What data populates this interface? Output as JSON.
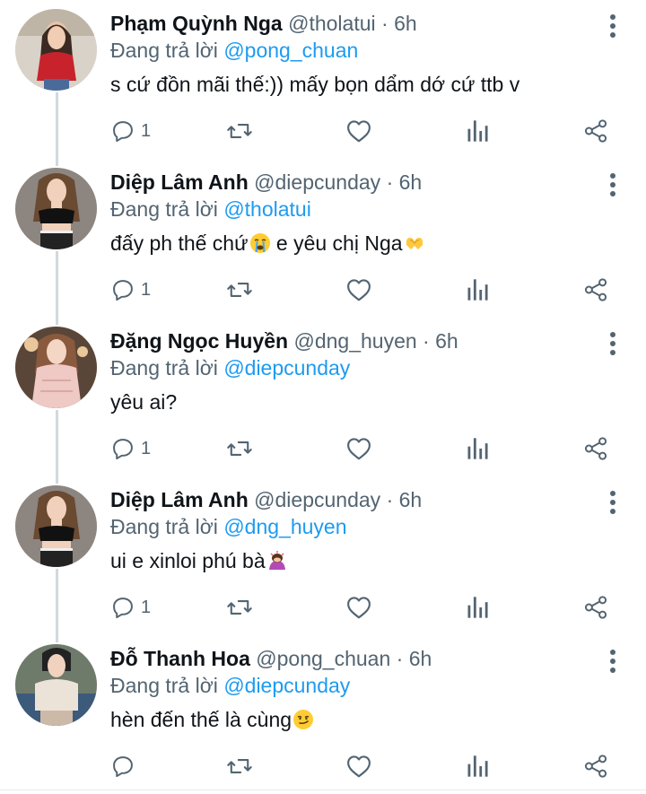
{
  "colors": {
    "link": "#1d9bf0",
    "secondary_text": "#536471",
    "primary_text": "#0f1419",
    "thread_line": "#cfd9de"
  },
  "tweets": [
    {
      "display_name": "Phạm Quỳnh Nga",
      "handle": "@tholatui",
      "separator": "·",
      "time": "6h",
      "replying_prefix": "Đang trả lời",
      "replying_to": "@pong_chuan",
      "text": "s cứ đồn mãi thế:)) mấy bọn dẩm dớ cứ ttb v",
      "emoji": "",
      "reply_count": "1",
      "avatar_icon": "woman-red-top-avatar"
    },
    {
      "display_name": "Diệp Lâm Anh",
      "handle": "@diepcunday",
      "separator": "·",
      "time": "6h",
      "replying_prefix": "Đang trả lời",
      "replying_to": "@tholatui",
      "text": "đấy ph thế chứ",
      "text_after_emoji": " e yêu chị Nga",
      "emoji": "crying-face-icon",
      "emoji2": "heart-hands-icon",
      "reply_count": "1",
      "avatar_icon": "woman-black-outfit-avatar"
    },
    {
      "display_name": "Đặng Ngọc Huyền",
      "handle": "@dng_huyen",
      "separator": "·",
      "time": "6h",
      "replying_prefix": "Đang trả lời",
      "replying_to": "@diepcunday",
      "text": "yêu ai?",
      "emoji": "",
      "reply_count": "1",
      "avatar_icon": "woman-pink-dress-avatar"
    },
    {
      "display_name": "Diệp Lâm Anh",
      "handle": "@diepcunday",
      "separator": "·",
      "time": "6h",
      "replying_prefix": "Đang trả lời",
      "replying_to": "@dng_huyen",
      "text": "ui e xinloi phú bà",
      "emoji": "bowing-woman-icon",
      "reply_count": "1",
      "avatar_icon": "woman-black-outfit-avatar"
    },
    {
      "display_name": "Đỗ Thanh Hoa",
      "handle": "@pong_chuan",
      "separator": "·",
      "time": "6h",
      "replying_prefix": "Đang trả lời",
      "replying_to": "@diepcunday",
      "text": "hèn đến thế là cùng",
      "emoji": "smirking-face-icon",
      "reply_count": "",
      "avatar_icon": "woman-white-blouse-avatar"
    }
  ]
}
